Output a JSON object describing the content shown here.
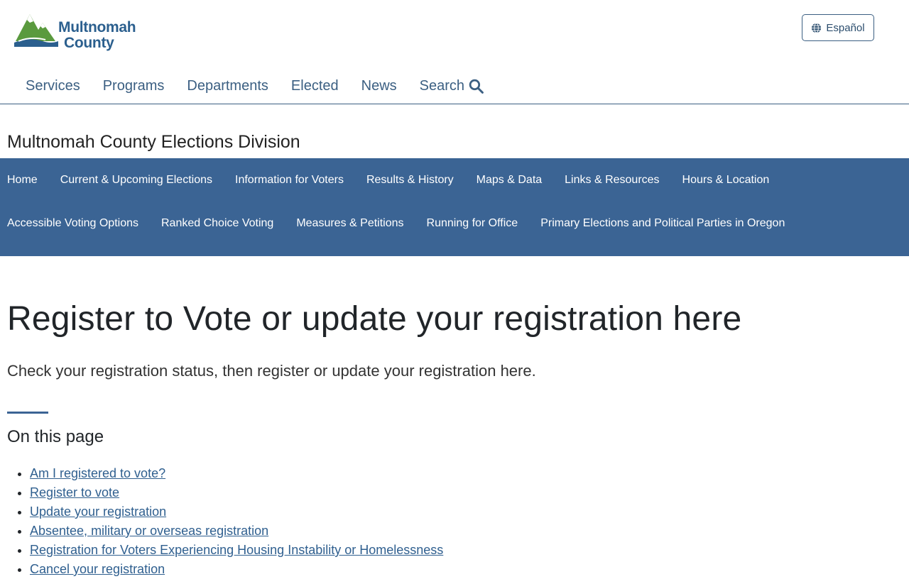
{
  "header": {
    "logo": {
      "line1": "Multnomah",
      "line2": "County"
    },
    "language_button": "Español",
    "nav": [
      "Services",
      "Programs",
      "Departments",
      "Elected",
      "News",
      "Search"
    ]
  },
  "division": {
    "title": "Multnomah County Elections Division",
    "nav_row1": [
      "Home",
      "Current & Upcoming Elections",
      "Information for Voters",
      "Results & History",
      "Maps & Data",
      "Links & Resources",
      "Hours & Location"
    ],
    "nav_row2": [
      "Accessible Voting Options",
      "Ranked Choice Voting",
      "Measures & Petitions",
      "Running for Office",
      "Primary Elections and Political Parties in Oregon"
    ]
  },
  "main": {
    "title": "Register to Vote or update your registration here",
    "lead": "Check your registration status, then register or update your registration here.",
    "toc_heading": "On this page",
    "toc": [
      "Am I registered to vote?",
      "Register to vote",
      "Update your registration",
      "Absentee, military or overseas registration",
      "Registration for Voters Experiencing Housing Instability or Homelessness",
      "Cancel your registration"
    ]
  },
  "colors": {
    "brand_blue": "#3b6494",
    "link": "#2f5f8f",
    "logo_green": "#5a9a3e"
  }
}
